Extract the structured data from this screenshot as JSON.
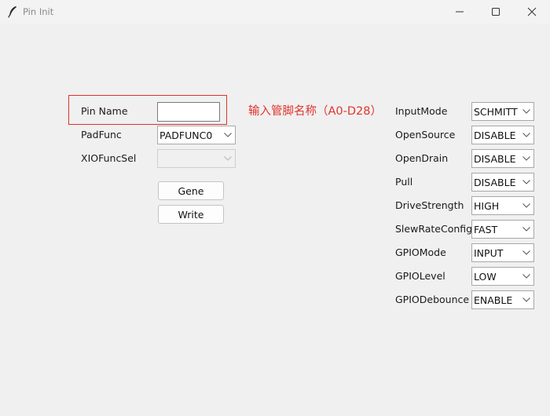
{
  "window": {
    "title": "Pin Init",
    "icons": [
      "feather-icon",
      "minimize-icon",
      "maximize-icon",
      "close-icon"
    ]
  },
  "left": {
    "pin_name": {
      "label": "Pin Name",
      "value": ""
    },
    "hint": "输入管脚名称（A0-D28）",
    "pad_func": {
      "label": "PadFunc",
      "value": "PADFUNC0"
    },
    "xio_func_sel": {
      "label": "XIOFuncSel",
      "value": ""
    },
    "gene_button": "Gene",
    "write_button": "Write"
  },
  "right": {
    "fields": [
      {
        "label": "InputMode",
        "value": "SCHMITT"
      },
      {
        "label": "OpenSource",
        "value": "DISABLE"
      },
      {
        "label": "OpenDrain",
        "value": "DISABLE"
      },
      {
        "label": "Pull",
        "value": "DISABLE"
      },
      {
        "label": "DriveStrength",
        "value": "HIGH"
      },
      {
        "label": "SlewRateConfig",
        "value": "FAST"
      },
      {
        "label": "GPIOMode",
        "value": "INPUT"
      },
      {
        "label": "GPIOLevel",
        "value": "LOW"
      },
      {
        "label": "GPIODebounce",
        "value": "ENABLE"
      }
    ]
  },
  "colors": {
    "highlight_border": "#d9342b",
    "hint_text": "#e0342c",
    "window_bg": "#f0f0f0"
  }
}
